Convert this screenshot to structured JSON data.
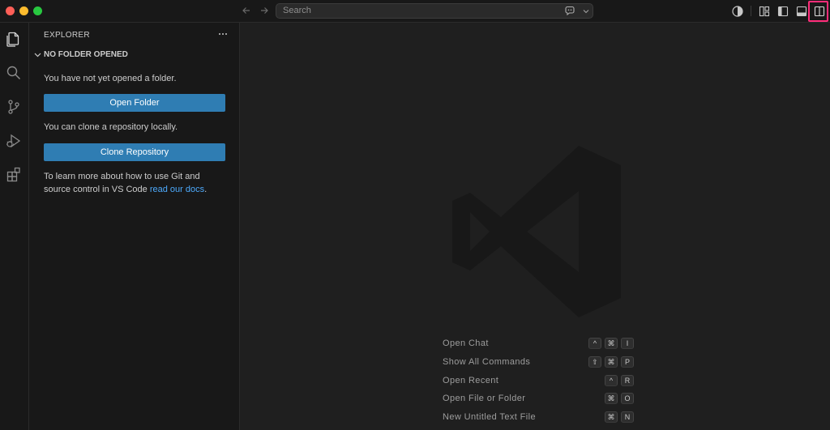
{
  "titlebar": {
    "search_label": "Search"
  },
  "activity_bar": {
    "items": [
      "explorer",
      "search",
      "source-control",
      "run-and-debug",
      "extensions"
    ]
  },
  "sidebar": {
    "title": "EXPLORER",
    "more_label": "···",
    "section_title": "NO FOLDER OPENED",
    "no_folder_text": "You have not yet opened a folder.",
    "open_folder_button": "Open Folder",
    "clone_text": "You can clone a repository locally.",
    "clone_button": "Clone Repository",
    "learn_more_line1": "To learn more about how to use Git and",
    "learn_more_line2_prefix": "source control in VS Code ",
    "learn_more_link": "read our docs",
    "learn_more_suffix": "."
  },
  "editor": {
    "shortcuts": [
      {
        "label": "Open Chat",
        "keys": [
          "^",
          "⌘",
          "I"
        ]
      },
      {
        "label": "Show All Commands",
        "keys": [
          "⇧",
          "⌘",
          "P"
        ]
      },
      {
        "label": "Open Recent",
        "keys": [
          "^",
          "R"
        ]
      },
      {
        "label": "Open File or Folder",
        "keys": [
          "⌘",
          "O"
        ]
      },
      {
        "label": "New Untitled Text File",
        "keys": [
          "⌘",
          "N"
        ]
      }
    ]
  },
  "colors": {
    "accent_button": "#2f7db3",
    "link": "#4daafc",
    "highlight": "#ff2d7a"
  }
}
